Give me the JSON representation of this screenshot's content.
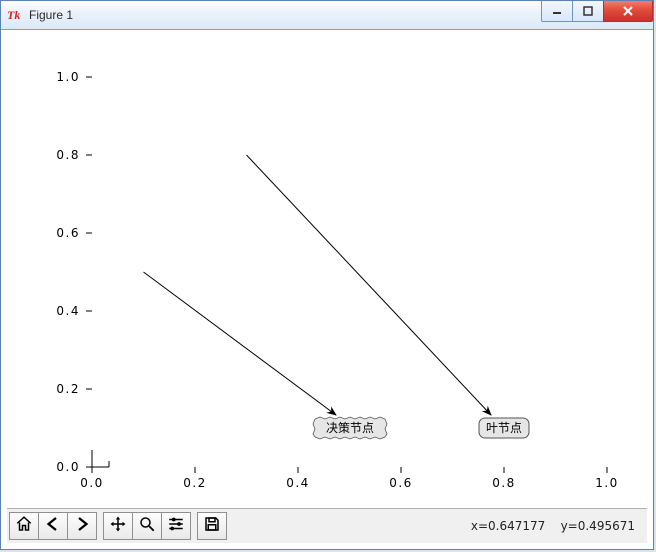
{
  "window": {
    "title": "Figure 1"
  },
  "chart_data": {
    "type": "line",
    "title": "",
    "xlabel": "",
    "ylabel": "",
    "xlim": [
      0.0,
      1.0
    ],
    "ylim": [
      0.0,
      1.0
    ],
    "xticks": [
      "0.0",
      "0.2",
      "0.4",
      "0.6",
      "0.8",
      "1.0"
    ],
    "yticks": [
      "0.0",
      "0.2",
      "0.4",
      "0.6",
      "0.8",
      "1.0"
    ],
    "arrows": [
      {
        "from": [
          0.1,
          0.5
        ],
        "to": [
          0.475,
          0.135
        ]
      },
      {
        "from": [
          0.3,
          0.8
        ],
        "to": [
          0.775,
          0.135
        ]
      }
    ],
    "annotations": [
      {
        "xy": [
          0.5,
          0.1
        ],
        "text": "决策节点",
        "style": "sawtooth"
      },
      {
        "xy": [
          0.8,
          0.1
        ],
        "text": "叶节点",
        "style": "round"
      }
    ]
  },
  "status": {
    "x_label": "x=0.647177",
    "y_label": "y=0.495671"
  },
  "toolbar": {
    "home": "Home",
    "back": "Back",
    "forward": "Forward",
    "pan": "Pan",
    "zoom": "Zoom",
    "configure": "Configure subplots",
    "save": "Save"
  }
}
